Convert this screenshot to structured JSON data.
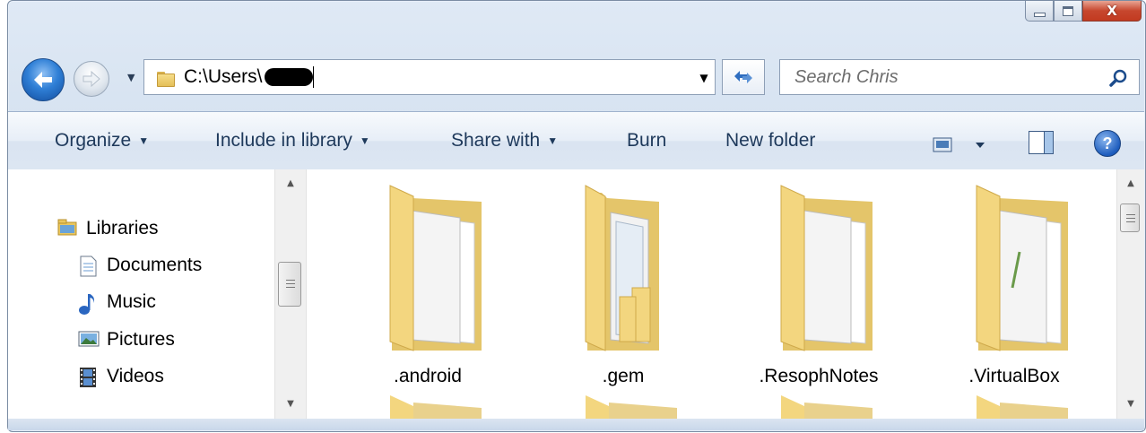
{
  "window": {
    "caption_buttons": [
      "minimize",
      "maximize",
      "close"
    ]
  },
  "nav": {
    "back_icon": "back-arrow-icon",
    "forward_icon": "forward-arrow-icon"
  },
  "address": {
    "path": "C:\\Users\\",
    "redacted": true
  },
  "search": {
    "placeholder": "Search Chris"
  },
  "commandbar": {
    "organize": "Organize",
    "include": "Include in library",
    "share": "Share with",
    "burn": "Burn",
    "new_folder": "New folder"
  },
  "sidebar": {
    "items": [
      {
        "label": "Libraries",
        "icon": "libraries-icon"
      },
      {
        "label": "Documents",
        "icon": "documents-icon"
      },
      {
        "label": "Music",
        "icon": "music-icon"
      },
      {
        "label": "Pictures",
        "icon": "pictures-icon"
      },
      {
        "label": "Videos",
        "icon": "videos-icon"
      }
    ]
  },
  "folders": [
    {
      "name": ".android"
    },
    {
      "name": ".gem"
    },
    {
      "name": ".ResophNotes"
    },
    {
      "name": ".VirtualBox"
    }
  ],
  "colors": {
    "accent": "#1e395b",
    "folder": "#f2d98b"
  }
}
